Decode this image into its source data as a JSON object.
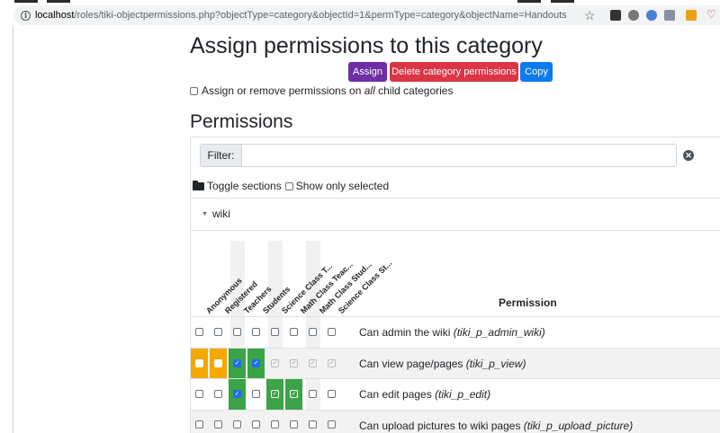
{
  "browser": {
    "url_host": "localhost",
    "url_rest": "/roles/tiki-objectpermissions.php?objectType=category&objectId=1&permType=category&objectName=Handouts"
  },
  "page": {
    "title": "Assign permissions to this category",
    "buttons": {
      "assign": "Assign",
      "delete": "Delete category permissions",
      "copy": "Copy"
    },
    "child_label_pre": "Assign or remove permissions on ",
    "child_label_em": "all",
    "child_label_post": " child categories",
    "permissions_heading": "Permissions",
    "filter_label": "Filter:",
    "filter_value": "",
    "toggle_sections": "Toggle sections",
    "show_only_selected": "Show only selected",
    "section": "wiki",
    "permission_col": "Permission"
  },
  "groups": [
    "Anonymous",
    "Registered",
    "Teachers",
    "Students",
    "Science Class T...",
    "Math Class Teac...",
    "Math Class Stud...",
    "Science Class St..."
  ],
  "rows": [
    {
      "label": "Can admin the wiki ",
      "perm": "(tiki_p_admin_wiki)"
    },
    {
      "label": "Can view page/pages ",
      "perm": "(tiki_p_view)"
    },
    {
      "label": "Can edit pages ",
      "perm": "(tiki_p_edit)"
    },
    {
      "label": "Can upload pictures to wiki pages ",
      "perm": "(tiki_p_upload_picture)"
    }
  ],
  "colors": {
    "orange": "#f5a800",
    "green": "#3aa447",
    "blue": "#1f6cf0"
  }
}
